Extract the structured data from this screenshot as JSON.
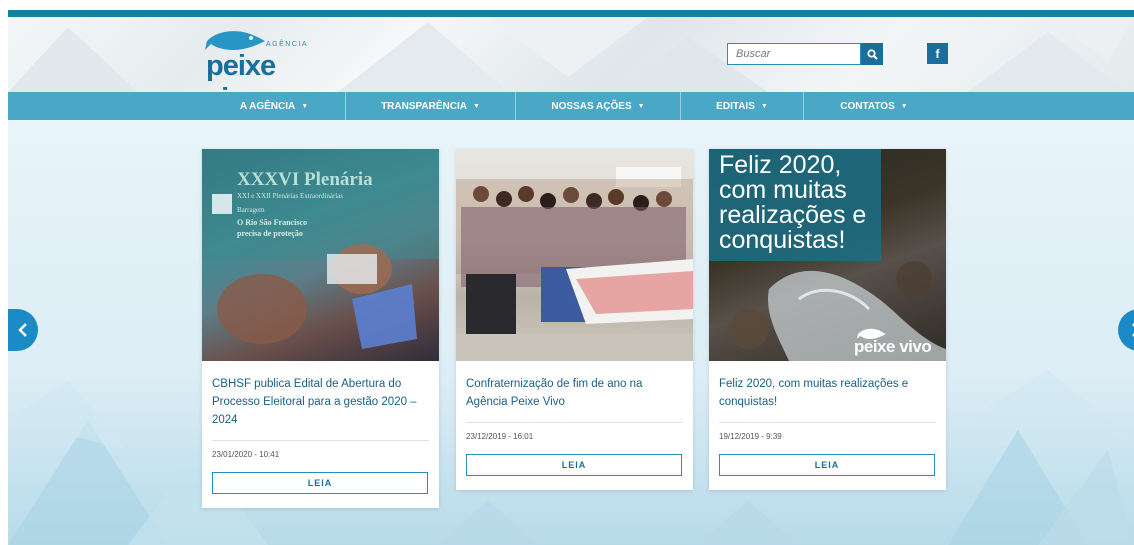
{
  "header": {
    "logo": {
      "small": "AGÊNCIA",
      "main": "peixe vivo"
    },
    "search": {
      "placeholder": "Buscar",
      "icon": "search-icon"
    },
    "social": {
      "facebook": "f"
    }
  },
  "nav": {
    "items": [
      {
        "label": "A AGÊNCIA"
      },
      {
        "label": "TRANSPARÊNCIA"
      },
      {
        "label": "NOSSAS AÇÕES"
      },
      {
        "label": "EDITAIS"
      },
      {
        "label": "CONTATOS"
      }
    ],
    "caret": "▼"
  },
  "slides": [
    {
      "image_text": {
        "line1": "XXXVI Plenária",
        "line2": "XXI e XXII Plenárias Extraordinárias",
        "line3": "Barragem",
        "line4": "O Rio São Francisco",
        "line5": "precisa de proteção"
      },
      "title": "CBHSF publica Edital de Abertura do Processo Eleitoral para a gestão 2020 – 2024",
      "date": "23/01/2020 - 10:41",
      "button": "LEIA"
    },
    {
      "title": "Confraternização de fim de ano na Agência Peixe Vivo",
      "date": "23/12/2019 - 16:01",
      "button": "LEIA"
    },
    {
      "image_text": {
        "line1": "Feliz 2020,",
        "line2": "com muitas",
        "line3": "realizações e",
        "line4": "conquistas!",
        "logo": "peixe vivo"
      },
      "title": "Feliz 2020, com muitas realizações e conquistas!",
      "date": "19/12/2019 - 9:39",
      "button": "LEIA"
    }
  ],
  "colors": {
    "brand": "#1a6f9a",
    "nav": "#4aa7c6",
    "topbar": "#167fa3",
    "arrow": "#1a8bc7"
  }
}
